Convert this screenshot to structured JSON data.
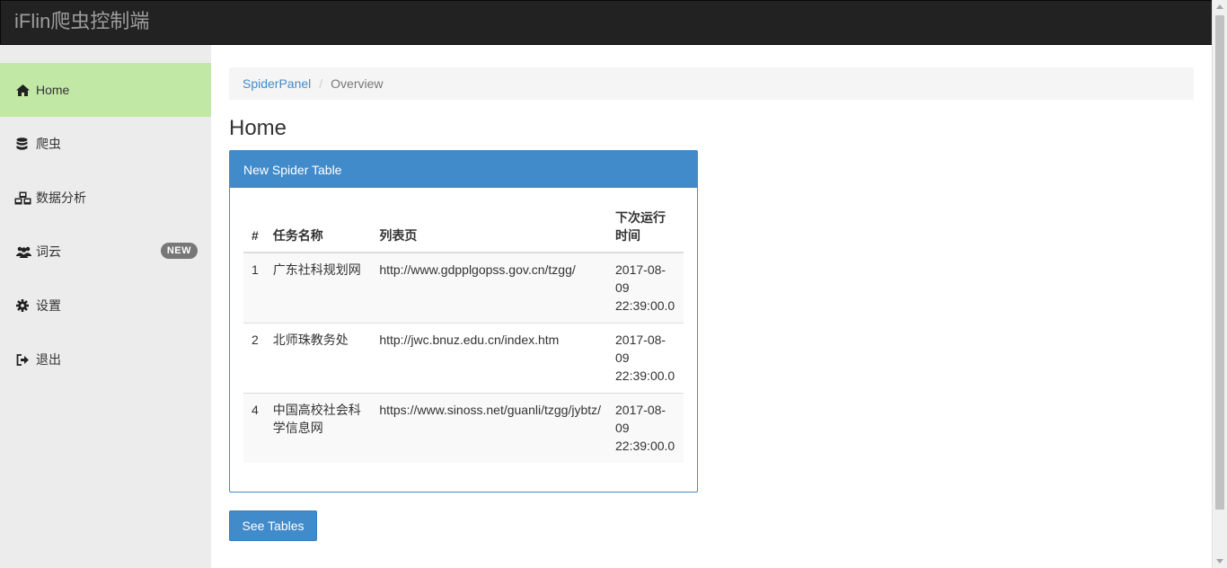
{
  "app": {
    "brand": "iFlin爬虫控制端"
  },
  "sidebar": {
    "items": [
      {
        "label": "Home",
        "icon": "home-icon",
        "active": true
      },
      {
        "label": "爬虫",
        "icon": "database-icon"
      },
      {
        "label": "数据分析",
        "icon": "cubes-icon"
      },
      {
        "label": "词云",
        "icon": "users-icon",
        "badge": "NEW"
      },
      {
        "label": "设置",
        "icon": "gear-icon"
      },
      {
        "label": "退出",
        "icon": "sign-out-icon"
      }
    ]
  },
  "breadcrumb": {
    "link": "SpiderPanel",
    "separator": "/",
    "current": "Overview"
  },
  "page": {
    "title": "Home"
  },
  "panel": {
    "heading": "New Spider Table",
    "columns": [
      "#",
      "任务名称",
      "列表页",
      "下次运行时间"
    ],
    "rows": [
      {
        "id": "1",
        "name": "广东社科规划网",
        "url": "http://www.gdpplgopss.gov.cn/tzgg/",
        "next_run": "2017-08-09 22:39:00.0"
      },
      {
        "id": "2",
        "name": "北师珠教务处",
        "url": "http://jwc.bnuz.edu.cn/index.htm",
        "next_run": "2017-08-09 22:39:00.0"
      },
      {
        "id": "4",
        "name": "中国高校社会科学信息网",
        "url": "https://www.sinoss.net/guanli/tzgg/jybtz/",
        "next_run": "2017-08-09 22:39:00.0"
      }
    ]
  },
  "actions": {
    "see_tables_label": "See Tables"
  },
  "colors": {
    "navbar": "#222222",
    "brand_text": "#9d9d9d",
    "sidebar_bg": "#ececec",
    "sidebar_active": "#c2e8a6",
    "primary": "#428bca"
  }
}
